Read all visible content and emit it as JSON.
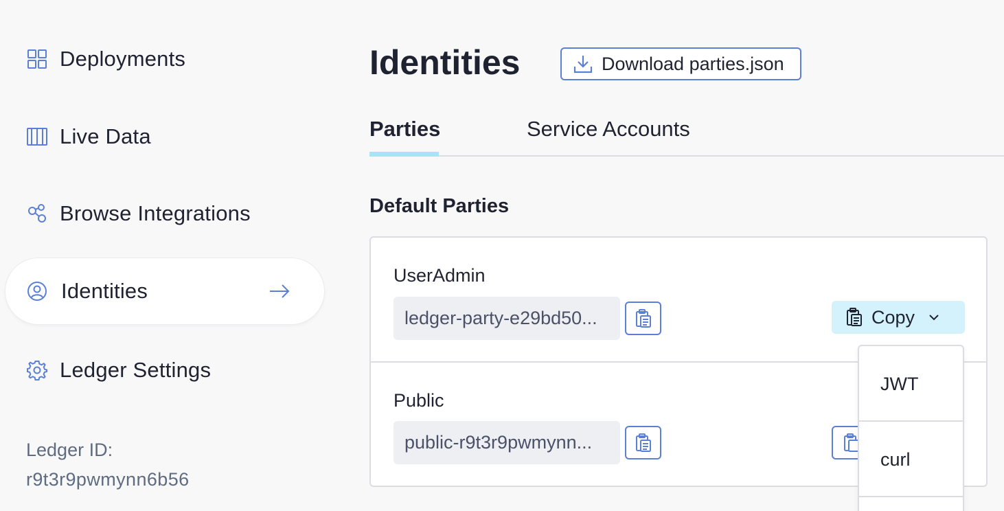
{
  "sidebar": {
    "items": [
      {
        "label": "Deployments",
        "icon": "grid-icon"
      },
      {
        "label": "Live Data",
        "icon": "columns-icon"
      },
      {
        "label": "Browse Integrations",
        "icon": "share-nodes-icon"
      },
      {
        "label": "Identities",
        "icon": "user-circle-icon",
        "active": true
      },
      {
        "label": "Ledger Settings",
        "icon": "gear-icon"
      }
    ],
    "ledger_id_label": "Ledger ID:",
    "ledger_id_value": "r9t3r9pwmynn6b56"
  },
  "main": {
    "title": "Identities",
    "download_button": "Download parties.json",
    "tabs": [
      {
        "label": "Parties",
        "active": true
      },
      {
        "label": "Service Accounts",
        "active": false
      }
    ],
    "section_title": "Default Parties",
    "parties": [
      {
        "name": "UserAdmin",
        "id": "ledger-party-e29bd50..."
      },
      {
        "name": "Public",
        "id": "public-r9t3r9pwmynn..."
      }
    ],
    "copy_button": "Copy",
    "copy_menu": [
      "JWT",
      "curl"
    ]
  },
  "colors": {
    "accent": "#5b7fd6",
    "tab_underline": "#a5e6f5",
    "copy_bg": "#d3f2fb",
    "field_bg": "#eeeff2"
  }
}
